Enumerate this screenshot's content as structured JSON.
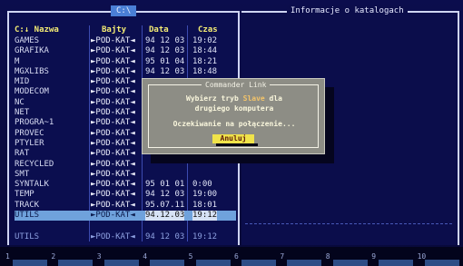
{
  "left_panel": {
    "path_label": "C:\\",
    "headers": {
      "name": "C:↓ Nazwa",
      "size": "Bajty",
      "date": "Data",
      "time": "Czas"
    },
    "rows": [
      {
        "name": "GAMES",
        "size": "►POD-KAT◄",
        "date": "94 12 03",
        "time": "19:02"
      },
      {
        "name": "GRAFIKA",
        "size": "►POD-KAT◄",
        "date": "94 12 03",
        "time": "18:44"
      },
      {
        "name": "M",
        "size": "►POD-KAT◄",
        "date": "95 01 04",
        "time": "18:21"
      },
      {
        "name": "MGXLIBS",
        "size": "►POD-KAT◄",
        "date": "94 12 03",
        "time": "18:48"
      },
      {
        "name": "MID",
        "size": "►POD-KAT◄",
        "date": "",
        "time": ""
      },
      {
        "name": "MODECOM",
        "size": "►POD-KAT◄",
        "date": "",
        "time": ""
      },
      {
        "name": "NC",
        "size": "►POD-KAT◄",
        "date": "",
        "time": ""
      },
      {
        "name": "NET",
        "size": "►POD-KAT◄",
        "date": "",
        "time": ""
      },
      {
        "name": "PROGRA~1",
        "size": "►POD-KAT◄",
        "date": "",
        "time": ""
      },
      {
        "name": "PROVEC",
        "size": "►POD-KAT◄",
        "date": "",
        "time": ""
      },
      {
        "name": "PTYLER",
        "size": "►POD-KAT◄",
        "date": "",
        "time": ""
      },
      {
        "name": "RAT",
        "size": "►POD-KAT◄",
        "date": "",
        "time": ""
      },
      {
        "name": "RECYCLED",
        "size": "►POD-KAT◄",
        "date": "",
        "time": ""
      },
      {
        "name": "SMT",
        "size": "►POD-KAT◄",
        "date": "",
        "time": ""
      },
      {
        "name": "SYNTALK",
        "size": "►POD-KAT◄",
        "date": "95 01 01",
        "time": "0:00"
      },
      {
        "name": "TEMP",
        "size": "►POD-KAT◄",
        "date": "94 12 03",
        "time": "19:00"
      },
      {
        "name": "TRACK",
        "size": "►POD-KAT◄",
        "date": "95.07.11",
        "time": "18:01"
      },
      {
        "name": "UTILS",
        "size": "►POD-KAT◄",
        "date": "94.12.03",
        "time": "19:12",
        "cursor": true
      }
    ],
    "footer": {
      "name": "UTILS",
      "size": "►POD-KAT◄",
      "date": "94 12 03",
      "time": "19:12"
    }
  },
  "right_panel": {
    "title": "Informacje o katalogach"
  },
  "dialog": {
    "title": "Commander Link",
    "line1_pre": "Wybierz tryb ",
    "line1_hl": "Slave",
    "line1_post": " dla",
    "line2": "drugiego komputera",
    "line3": "Oczekiwanie na połączenie...",
    "cancel_label": "Anuluj"
  },
  "keybar": {
    "keys": [
      "1",
      "2",
      "3",
      "4",
      "5",
      "6",
      "7",
      "8",
      "9",
      "10"
    ]
  },
  "colors": {
    "panel_bg": "#0b0e4f",
    "header_yellow": "#f4ec74",
    "cursor_bg": "#6fa2dc",
    "dialog_bg": "#8d8d85",
    "button_bg": "#f0e34a"
  }
}
